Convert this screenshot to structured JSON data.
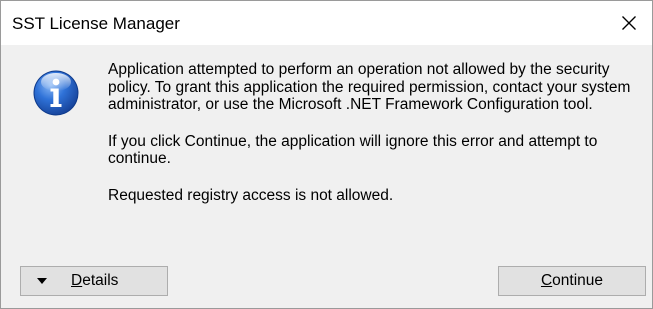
{
  "window": {
    "title": "SST License Manager"
  },
  "icons": {
    "close": "close-icon",
    "info": "info-icon",
    "details_arrow": "caret-down-icon"
  },
  "colors": {
    "info_blue": "#1f5fc5",
    "titlebar_bg": "#ffffff",
    "body_bg": "#f0f0f0",
    "button_bg": "#e1e1e1",
    "button_border": "#adadad"
  },
  "message": {
    "paragraph1": "Application attempted to perform an operation not allowed by the security policy. To grant this application the required permission, contact your system administrator, or use the Microsoft .NET Framework Configuration tool.",
    "paragraph2": "If you click Continue, the application will ignore this error and attempt to continue.",
    "paragraph3": "Requested registry access is not allowed."
  },
  "buttons": {
    "details_label": "Details",
    "continue_label": "Continue"
  }
}
